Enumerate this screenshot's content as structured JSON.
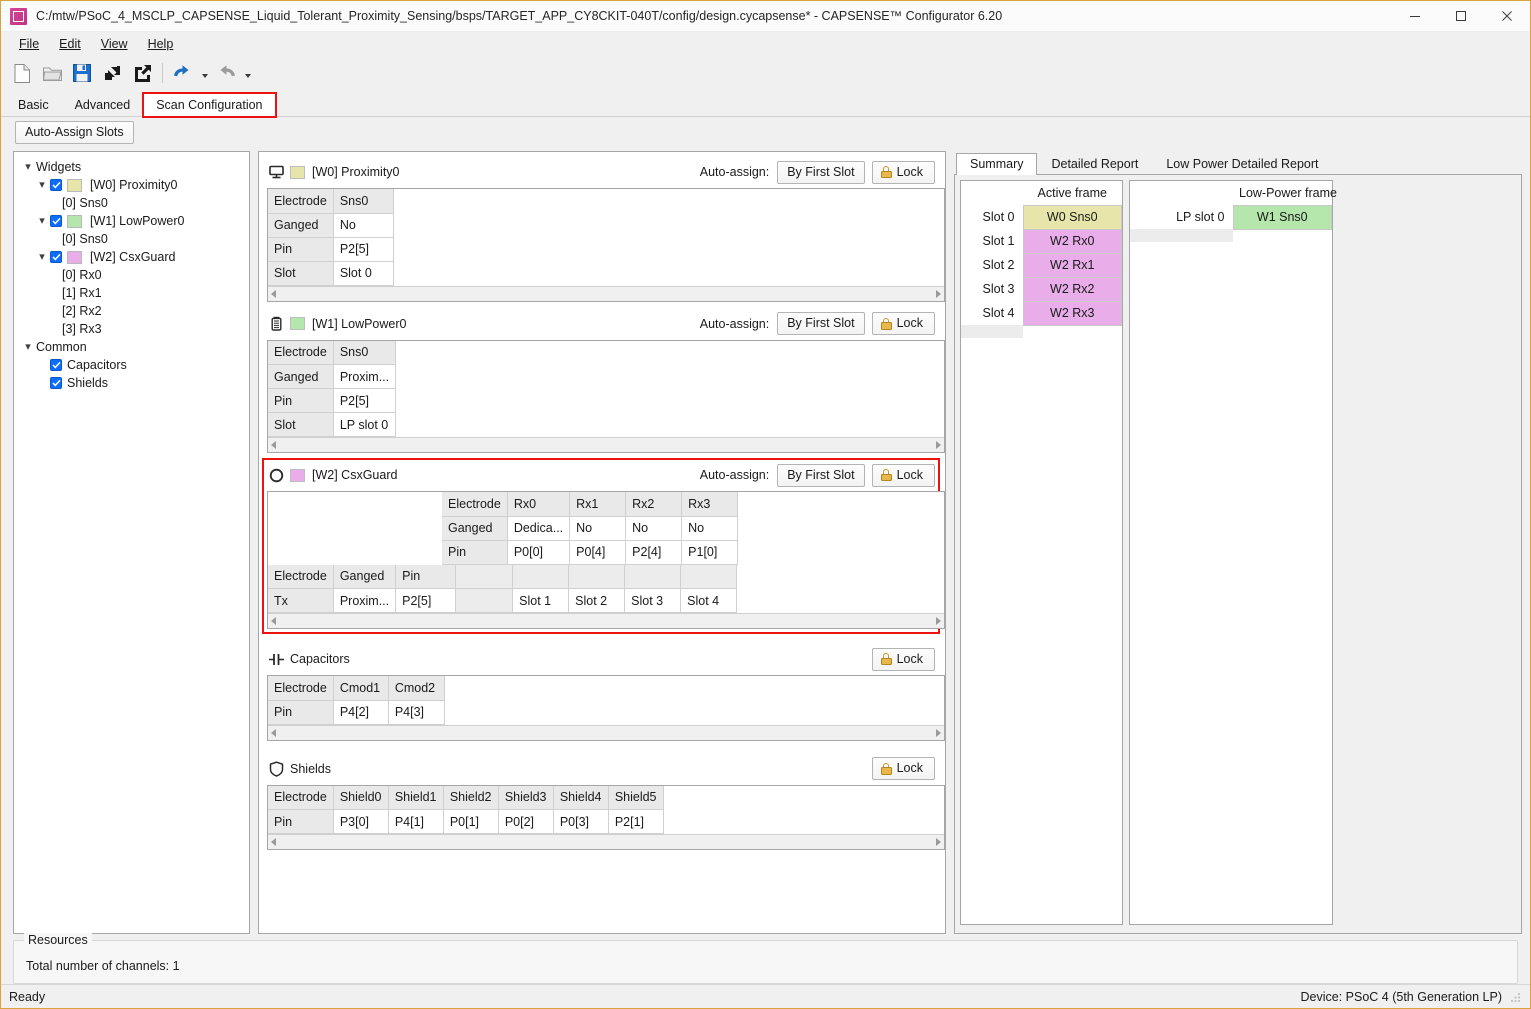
{
  "window": {
    "title": "C:/mtw/PSoC_4_MSCLP_CAPSENSE_Liquid_Tolerant_Proximity_Sensing/bsps/TARGET_APP_CY8CKIT-040T/config/design.cycapsense* - CAPSENSE™ Configurator 6.20",
    "app_icon": "capsense-app-icon",
    "controls": {
      "minimize": "minimize-icon",
      "maximize": "maximize-icon",
      "close": "close-icon"
    }
  },
  "menubar": {
    "items": [
      "File",
      "Edit",
      "View",
      "Help"
    ]
  },
  "toolbar": {
    "items": [
      {
        "name": "new-file-icon",
        "enabled": true
      },
      {
        "name": "open-folder-icon",
        "enabled": false
      },
      {
        "name": "save-icon",
        "enabled": true
      },
      {
        "name": "import-icon",
        "enabled": true
      },
      {
        "name": "export-icon",
        "enabled": true
      },
      {
        "name": "undo-icon",
        "enabled": true
      },
      {
        "name": "redo-icon",
        "enabled": false
      }
    ]
  },
  "tabs": {
    "items": [
      "Basic",
      "Advanced",
      "Scan Configuration"
    ],
    "active": "Scan Configuration"
  },
  "actions": {
    "auto_assign_slots": "Auto-Assign Slots"
  },
  "tree": {
    "root_label": "Widgets",
    "widgets": [
      {
        "label": "[W0] Proximity0",
        "checked": true,
        "color": "#e8e5ab",
        "children": [
          "[0] Sns0"
        ]
      },
      {
        "label": "[W1] LowPower0",
        "checked": true,
        "color": "#b5e6ab",
        "children": [
          "[0] Sns0"
        ]
      },
      {
        "label": "[W2] CsxGuard",
        "checked": true,
        "color": "#e9aee9",
        "children": [
          "[0] Rx0",
          "[1] Rx1",
          "[2] Rx2",
          "[3] Rx3"
        ]
      }
    ],
    "common": {
      "label": "Common",
      "items": [
        {
          "label": "Capacitors",
          "checked": true
        },
        {
          "label": "Shields",
          "checked": true
        }
      ]
    }
  },
  "widgets_panel": {
    "auto_assign_label": "Auto-assign:",
    "by_first_slot_label": "By First Slot",
    "lock_label": "Lock",
    "lock_icon": "lock-icon",
    "blocks": [
      {
        "id": "w0",
        "icon": "proximity-icon",
        "color": "#e8e5ab",
        "title": "[W0] Proximity0",
        "highlighted": false,
        "rows": [
          {
            "header": "Electrode",
            "cells": [
              "Sns0"
            ]
          },
          {
            "header": "Ganged",
            "cells": [
              "No"
            ]
          },
          {
            "header": "Pin",
            "cells": [
              "P2[5]"
            ]
          },
          {
            "header": "Slot",
            "cells": [
              "Slot 0"
            ]
          }
        ]
      },
      {
        "id": "w1",
        "icon": "battery-icon",
        "color": "#b5e6ab",
        "title": "[W1] LowPower0",
        "highlighted": false,
        "rows": [
          {
            "header": "Electrode",
            "cells": [
              "Sns0"
            ]
          },
          {
            "header": "Ganged",
            "cells": [
              "Proxim..."
            ]
          },
          {
            "header": "Pin",
            "cells": [
              "P2[5]"
            ]
          },
          {
            "header": "Slot",
            "cells": [
              "LP slot 0"
            ]
          }
        ]
      }
    ],
    "csx": {
      "id": "w2",
      "icon": "circle-icon",
      "color": "#e9aee9",
      "title": "[W2] CsxGuard",
      "highlighted": true,
      "rx_rows": [
        {
          "header": "Electrode",
          "cells": [
            "Rx0",
            "Rx1",
            "Rx2",
            "Rx3"
          ]
        },
        {
          "header": "Ganged",
          "cells": [
            "Dedica...",
            "No",
            "No",
            "No"
          ]
        },
        {
          "header": "Pin",
          "cells": [
            "P0[0]",
            "P0[4]",
            "P2[4]",
            "P1[0]"
          ]
        }
      ],
      "tx_headers": [
        "Electrode",
        "Ganged",
        "Pin"
      ],
      "tx_row": [
        "Tx",
        "Proxim...",
        "P2[5]"
      ],
      "slot_cells": [
        "Slot 1",
        "Slot 2",
        "Slot 3",
        "Slot 4"
      ]
    },
    "capacitors": {
      "icon": "capacitor-icon",
      "title": "Capacitors",
      "lock_label": "Lock",
      "rows": [
        {
          "header": "Electrode",
          "cells": [
            "Cmod1",
            "Cmod2"
          ]
        },
        {
          "header": "Pin",
          "cells": [
            "P4[2]",
            "P4[3]"
          ]
        }
      ]
    },
    "shields": {
      "icon": "shield-icon",
      "title": "Shields",
      "lock_label": "Lock",
      "rows": [
        {
          "header": "Electrode",
          "cells": [
            "Shield0",
            "Shield1",
            "Shield2",
            "Shield3",
            "Shield4",
            "Shield5"
          ]
        },
        {
          "header": "Pin",
          "cells": [
            "P3[0]",
            "P4[1]",
            "P0[1]",
            "P0[2]",
            "P0[3]",
            "P2[1]"
          ]
        }
      ]
    }
  },
  "report": {
    "tabs": [
      "Summary",
      "Detailed Report",
      "Low Power Detailed Report"
    ],
    "active_tab": "Summary",
    "active_frame": {
      "header": "Active frame",
      "rows": [
        {
          "slot": "Slot 0",
          "value": "W0 Sns0",
          "color": "#e8e5ab"
        },
        {
          "slot": "Slot 1",
          "value": "W2 Rx0",
          "color": "#e9aee9"
        },
        {
          "slot": "Slot 2",
          "value": "W2 Rx1",
          "color": "#e9aee9"
        },
        {
          "slot": "Slot 3",
          "value": "W2 Rx2",
          "color": "#e9aee9"
        },
        {
          "slot": "Slot 4",
          "value": "W2 Rx3",
          "color": "#e9aee9"
        }
      ]
    },
    "low_power_frame": {
      "header": "Low-Power frame",
      "rows": [
        {
          "slot": "LP slot 0",
          "value": "W1 Sns0",
          "color": "#b5e6ab"
        }
      ]
    }
  },
  "resources": {
    "legend": "Resources",
    "text": "Total number of channels: 1"
  },
  "statusbar": {
    "left": "Ready",
    "right": "Device: PSoC 4 (5th Generation LP)"
  }
}
